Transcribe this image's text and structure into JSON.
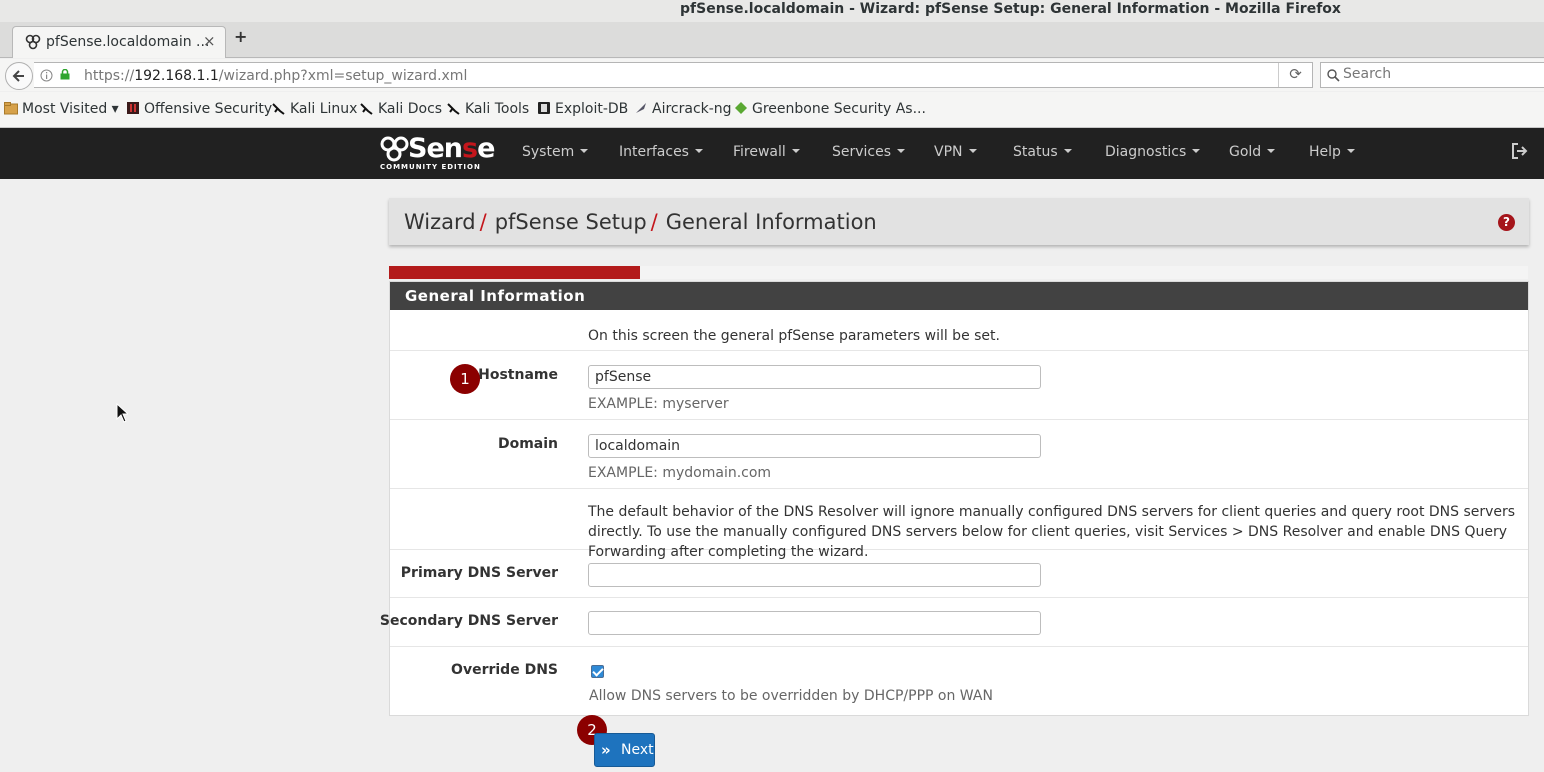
{
  "window": {
    "title": "pfSense.localdomain - Wizard: pfSense Setup: General Information - Mozilla Firefox"
  },
  "tab": {
    "label": "pfSense.localdomain ...",
    "close": "×",
    "new_tab": "+"
  },
  "navbar": {
    "back_icon": "back-arrow-icon",
    "url_prefix": "https://",
    "url_host": "192.168.1.1",
    "url_path": "/wizard.php?xml=setup_wizard.xml",
    "reload": "⟳",
    "search_placeholder": "Search"
  },
  "bookmarks": [
    {
      "label": "Most Visited ▾",
      "icon": "folder-icon"
    },
    {
      "label": "Offensive Security",
      "icon": "offsec-icon"
    },
    {
      "label": "Kali Linux",
      "icon": "kali-icon"
    },
    {
      "label": "Kali Docs",
      "icon": "kali-icon"
    },
    {
      "label": "Kali Tools",
      "icon": "kali-icon"
    },
    {
      "label": "Exploit-DB",
      "icon": "exploitdb-icon"
    },
    {
      "label": "Aircrack-ng",
      "icon": "aircrack-icon"
    },
    {
      "label": "Greenbone Security As...",
      "icon": "greenbone-icon"
    }
  ],
  "logo": {
    "main_a": "Sen",
    "main_b": "s",
    "main_c": "e",
    "sub": "COMMUNITY EDITION"
  },
  "menu": [
    "System",
    "Interfaces",
    "Firewall",
    "Services",
    "VPN",
    "Status",
    "Diagnostics",
    "Gold",
    "Help"
  ],
  "breadcrumb": {
    "items": [
      "Wizard",
      "pfSense Setup",
      "General Information"
    ],
    "separator": "/"
  },
  "help_icon": "?",
  "progress": {
    "percent": 22
  },
  "panel": {
    "title": "General Information",
    "intro": "On this screen the general pfSense parameters will be set.",
    "hostname": {
      "label": "Hostname",
      "value": "pfSense",
      "help": "EXAMPLE: myserver"
    },
    "domain": {
      "label": "Domain",
      "value": "localdomain",
      "help": "EXAMPLE: mydomain.com"
    },
    "dns_note": "The default behavior of the DNS Resolver will ignore manually configured DNS servers for client queries and query root DNS servers directly. To use the manually configured DNS servers below for client queries, visit Services > DNS Resolver and enable DNS Query Forwarding after completing the wizard.",
    "primary_dns": {
      "label": "Primary DNS Server",
      "value": ""
    },
    "secondary_dns": {
      "label": "Secondary DNS Server",
      "value": ""
    },
    "override_dns": {
      "label": "Override DNS",
      "checked": true,
      "help": "Allow DNS servers to be overridden by DHCP/PPP on WAN"
    }
  },
  "badges": [
    "1",
    "2"
  ],
  "next_button": {
    "label": "Next",
    "icon": "»"
  }
}
